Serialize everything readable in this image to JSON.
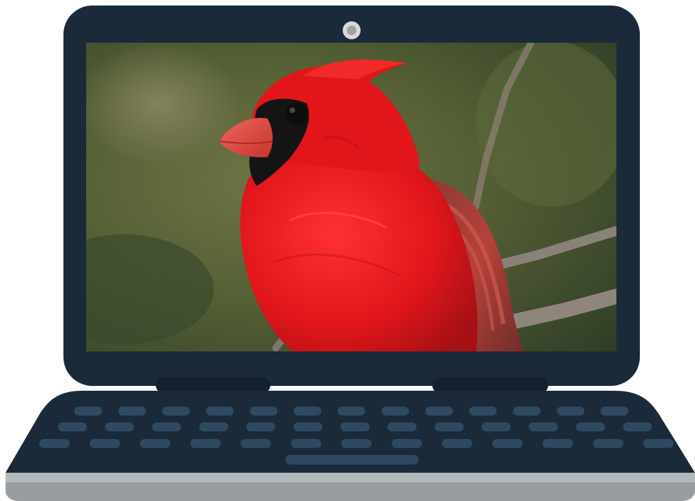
{
  "device": {
    "type": "laptop",
    "lid_color": "#1b2a38",
    "body_color": "#1b2a38",
    "base_color": "#b5b8bb",
    "key_color": "#2e4a60",
    "camera_icon": "webcam-icon"
  },
  "screen": {
    "content": "photo-northern-cardinal",
    "bird_color": "#e0161b",
    "background_color": "#4e5a36"
  },
  "keyboard": {
    "row_key_counts": [
      13,
      13,
      13
    ],
    "has_spacebar": true
  }
}
